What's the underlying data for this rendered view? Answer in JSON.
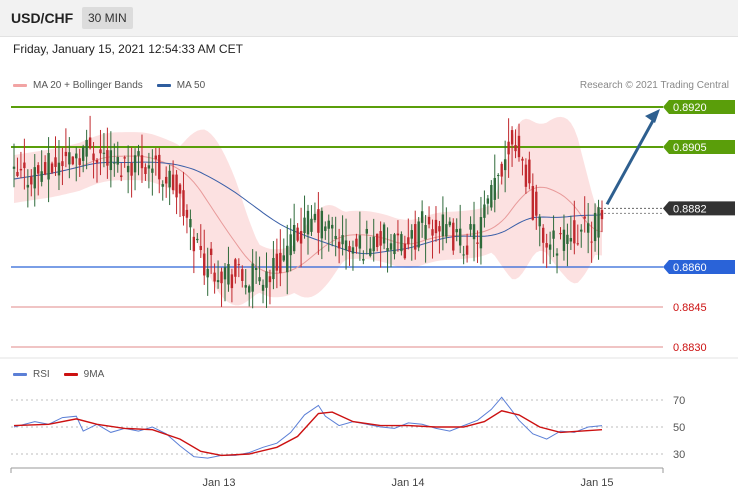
{
  "header": {
    "symbol": "USD/CHF",
    "timeframe": "30 MIN"
  },
  "datetime": "Friday, January 15, 2021 12:54:33 AM CET",
  "legend_main": [
    {
      "label": "MA 20 + Bollinger Bands",
      "color": "#f2a4a4"
    },
    {
      "label": "MA 50",
      "color": "#2f5d9e"
    }
  ],
  "credit": "Research © 2021 Trading Central",
  "legend_rsi": [
    {
      "label": "RSI",
      "color": "#5b7fd6"
    },
    {
      "label": "9MA",
      "color": "#cc1111"
    }
  ],
  "colors": {
    "up": "#2e6a3a",
    "down": "#c0282d",
    "resistance": "#5a9e0a",
    "support_blue": "#2a63d8",
    "support_red": "#e08a8a",
    "arrow": "#2e5f8f"
  },
  "chart_data": [
    {
      "type": "candlestick",
      "instrument": "USD/CHF",
      "timeframe": "30 MIN",
      "y_range": [
        0.8825,
        0.8925
      ],
      "x_labels": [
        "Jan 13",
        "Jan 14",
        "Jan 15"
      ],
      "levels": [
        {
          "value": "0.8920",
          "kind": "resistance"
        },
        {
          "value": "0.8905",
          "kind": "resistance"
        },
        {
          "value": "0.8882",
          "kind": "last"
        },
        {
          "value": "0.8860",
          "kind": "support"
        },
        {
          "value": "0.8845",
          "kind": "support-minor"
        },
        {
          "value": "0.8830",
          "kind": "support-minor"
        }
      ],
      "arrow": {
        "from": 0.8882,
        "to": 0.892,
        "direction": "up"
      },
      "close_path": [
        [
          0,
          0.8893
        ],
        [
          10,
          0.8897
        ],
        [
          18,
          0.8903
        ],
        [
          22,
          0.8905
        ],
        [
          26,
          0.8902
        ],
        [
          30,
          0.8898
        ],
        [
          36,
          0.8901
        ],
        [
          40,
          0.8898
        ],
        [
          46,
          0.8891
        ],
        [
          50,
          0.8877
        ],
        [
          55,
          0.8862
        ],
        [
          62,
          0.8858
        ],
        [
          66,
          0.8855
        ],
        [
          70,
          0.8856
        ],
        [
          74,
          0.8858
        ],
        [
          78,
          0.8864
        ],
        [
          82,
          0.8872
        ],
        [
          86,
          0.8877
        ],
        [
          90,
          0.8876
        ],
        [
          94,
          0.887
        ],
        [
          98,
          0.8866
        ],
        [
          102,
          0.887
        ],
        [
          106,
          0.8871
        ],
        [
          110,
          0.8867
        ],
        [
          114,
          0.8869
        ],
        [
          118,
          0.8875
        ],
        [
          122,
          0.8876
        ],
        [
          126,
          0.8872
        ],
        [
          130,
          0.8869
        ],
        [
          134,
          0.8873
        ],
        [
          138,
          0.8886
        ],
        [
          142,
          0.8902
        ],
        [
          144,
          0.891
        ],
        [
          146,
          0.8903
        ],
        [
          148,
          0.8895
        ],
        [
          150,
          0.8883
        ],
        [
          152,
          0.8874
        ],
        [
          155,
          0.8867
        ],
        [
          158,
          0.8872
        ],
        [
          162,
          0.8874
        ],
        [
          165,
          0.8873
        ],
        [
          169,
          0.8877
        ],
        [
          170,
          0.888
        ]
      ]
    },
    {
      "type": "line",
      "title": "RSI",
      "y_ticks": [
        30,
        50,
        70
      ],
      "series": [
        {
          "name": "RSI",
          "points": [
            [
              0,
              50
            ],
            [
              6,
              54
            ],
            [
              10,
              52
            ],
            [
              14,
              57
            ],
            [
              18,
              58
            ],
            [
              20,
              47
            ],
            [
              24,
              52
            ],
            [
              28,
              46
            ],
            [
              32,
              49
            ],
            [
              36,
              47
            ],
            [
              40,
              50
            ],
            [
              44,
              45
            ],
            [
              48,
              36
            ],
            [
              52,
              28
            ],
            [
              56,
              27
            ],
            [
              60,
              29
            ],
            [
              64,
              29
            ],
            [
              68,
              31
            ],
            [
              72,
              35
            ],
            [
              76,
              38
            ],
            [
              80,
              46
            ],
            [
              84,
              59
            ],
            [
              88,
              66
            ],
            [
              90,
              58
            ],
            [
              94,
              51
            ],
            [
              98,
              54
            ],
            [
              102,
              52
            ],
            [
              106,
              50
            ],
            [
              110,
              49
            ],
            [
              114,
              53
            ],
            [
              118,
              52
            ],
            [
              122,
              49
            ],
            [
              126,
              47
            ],
            [
              130,
              51
            ],
            [
              134,
              55
            ],
            [
              138,
              63
            ],
            [
              141,
              72
            ],
            [
              144,
              62
            ],
            [
              146,
              55
            ],
            [
              150,
              45
            ],
            [
              154,
              41
            ],
            [
              158,
              47
            ],
            [
              162,
              46
            ],
            [
              166,
              50
            ],
            [
              170,
              51
            ]
          ]
        },
        {
          "name": "9MA",
          "points": [
            [
              0,
              51
            ],
            [
              10,
              52
            ],
            [
              18,
              56
            ],
            [
              24,
              52
            ],
            [
              32,
              49
            ],
            [
              40,
              48
            ],
            [
              48,
              41
            ],
            [
              54,
              32
            ],
            [
              60,
              29
            ],
            [
              68,
              30
            ],
            [
              76,
              35
            ],
            [
              82,
              43
            ],
            [
              88,
              60
            ],
            [
              92,
              61
            ],
            [
              98,
              54
            ],
            [
              106,
              51
            ],
            [
              114,
              51
            ],
            [
              122,
              50
            ],
            [
              130,
              50
            ],
            [
              136,
              54
            ],
            [
              141,
              62
            ],
            [
              146,
              59
            ],
            [
              152,
              50
            ],
            [
              158,
              46
            ],
            [
              164,
              47
            ],
            [
              170,
              48
            ]
          ]
        }
      ]
    }
  ]
}
